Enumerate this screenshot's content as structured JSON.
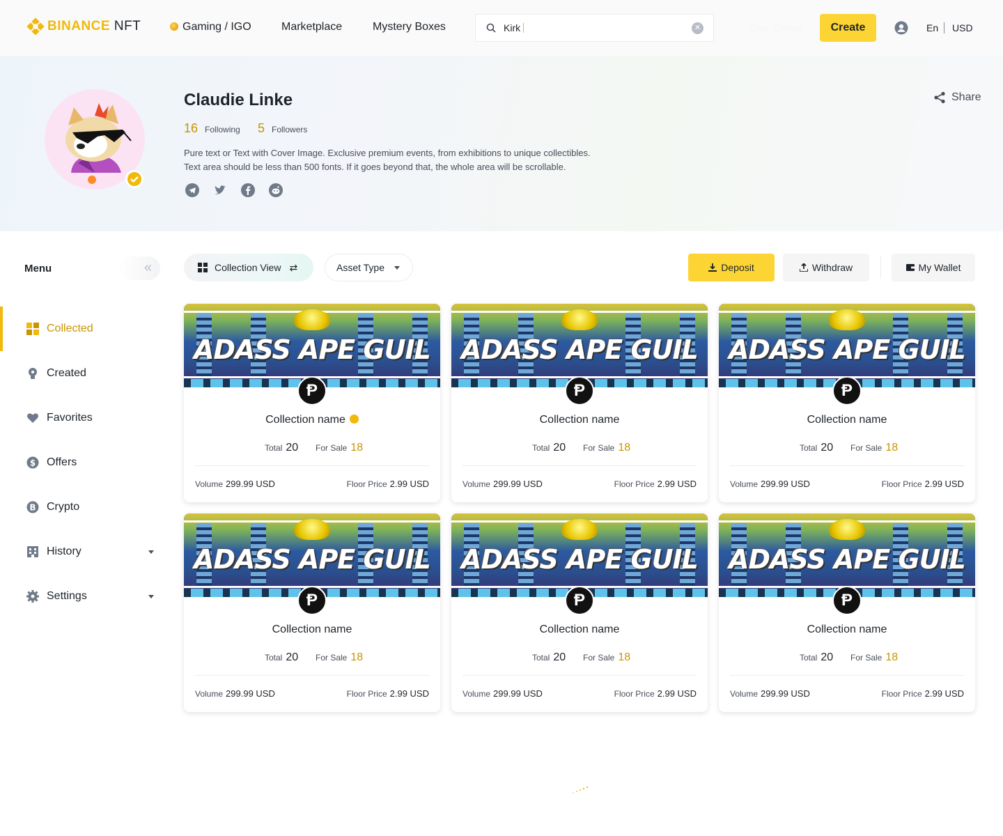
{
  "header": {
    "logo_text": "BINANCE",
    "logo_suffix": "NFT",
    "nav": [
      "Gaming / IGO",
      "Marketplace",
      "Mystery Boxes"
    ],
    "search_value": "Kirk",
    "faint_text": "User Center",
    "create_label": "Create",
    "language": "En",
    "currency": "USD"
  },
  "profile": {
    "name": "Claudie Linke",
    "following_count": "16",
    "following_label": "Following",
    "followers_count": "5",
    "followers_label": "Followers",
    "bio_line1": "Pure text or Text with Cover Image. Exclusive premium events, from exhibitions to unique collectibles.",
    "bio_line2": "Text area should be less than 500 fonts. If it goes beyond that, the whole area will be scrollable.",
    "socials": [
      "telegram-icon",
      "twitter-icon",
      "facebook-icon",
      "reddit-icon"
    ],
    "share_label": "Share"
  },
  "sidebar": {
    "title": "Menu",
    "items": [
      {
        "label": "Collected",
        "icon": "grid-icon",
        "active": true
      },
      {
        "label": "Created",
        "icon": "bulb-icon"
      },
      {
        "label": "Favorites",
        "icon": "heart-icon"
      },
      {
        "label": "Offers",
        "icon": "dollar-icon"
      },
      {
        "label": "Crypto",
        "icon": "bitcoin-icon"
      },
      {
        "label": "History",
        "icon": "history-icon",
        "expandable": true
      },
      {
        "label": "Settings",
        "icon": "gear-icon",
        "expandable": true
      }
    ]
  },
  "toolbar": {
    "collection_view": "Collection View",
    "asset_type": "Asset Type",
    "deposit": "Deposit",
    "withdraw": "Withdraw",
    "my_wallet": "My Wallet"
  },
  "cards": [
    {
      "cover_title": "ADASS APE GUIL",
      "name": "Collection name",
      "verified": true,
      "total_label": "Total",
      "total": "20",
      "sale_label": "For Sale",
      "for_sale": "18",
      "volume_label": "Volume",
      "volume": "299.99 USD",
      "floor_label": "Floor Price",
      "floor": "2.99 USD"
    },
    {
      "cover_title": "ADASS APE GUIL",
      "name": "Collection name",
      "verified": false,
      "total_label": "Total",
      "total": "20",
      "sale_label": "For Sale",
      "for_sale": "18",
      "volume_label": "Volume",
      "volume": "299.99 USD",
      "floor_label": "Floor Price",
      "floor": "2.99 USD"
    },
    {
      "cover_title": "ADASS APE GUIL",
      "name": "Collection name",
      "verified": false,
      "total_label": "Total",
      "total": "20",
      "sale_label": "For Sale",
      "for_sale": "18",
      "volume_label": "Volume",
      "volume": "299.99 USD",
      "floor_label": "Floor Price",
      "floor": "2.99 USD"
    },
    {
      "cover_title": "ADASS APE GUIL",
      "name": "Collection name",
      "verified": false,
      "total_label": "Total",
      "total": "20",
      "sale_label": "For Sale",
      "for_sale": "18",
      "volume_label": "Volume",
      "volume": "299.99 USD",
      "floor_label": "Floor Price",
      "floor": "2.99 USD"
    },
    {
      "cover_title": "ADASS APE GUIL",
      "name": "Collection name",
      "verified": false,
      "total_label": "Total",
      "total": "20",
      "sale_label": "For Sale",
      "for_sale": "18",
      "volume_label": "Volume",
      "volume": "299.99 USD",
      "floor_label": "Floor Price",
      "floor": "2.99 USD"
    },
    {
      "cover_title": "ADASS APE GUIL",
      "name": "Collection name",
      "verified": false,
      "total_label": "Total",
      "total": "20",
      "sale_label": "For Sale",
      "for_sale": "18",
      "volume_label": "Volume",
      "volume": "299.99 USD",
      "floor_label": "Floor Price",
      "floor": "2.99 USD"
    }
  ],
  "colors": {
    "accent": "#fcd535",
    "accent_text": "#c99400",
    "brand": "#f0b90b"
  }
}
